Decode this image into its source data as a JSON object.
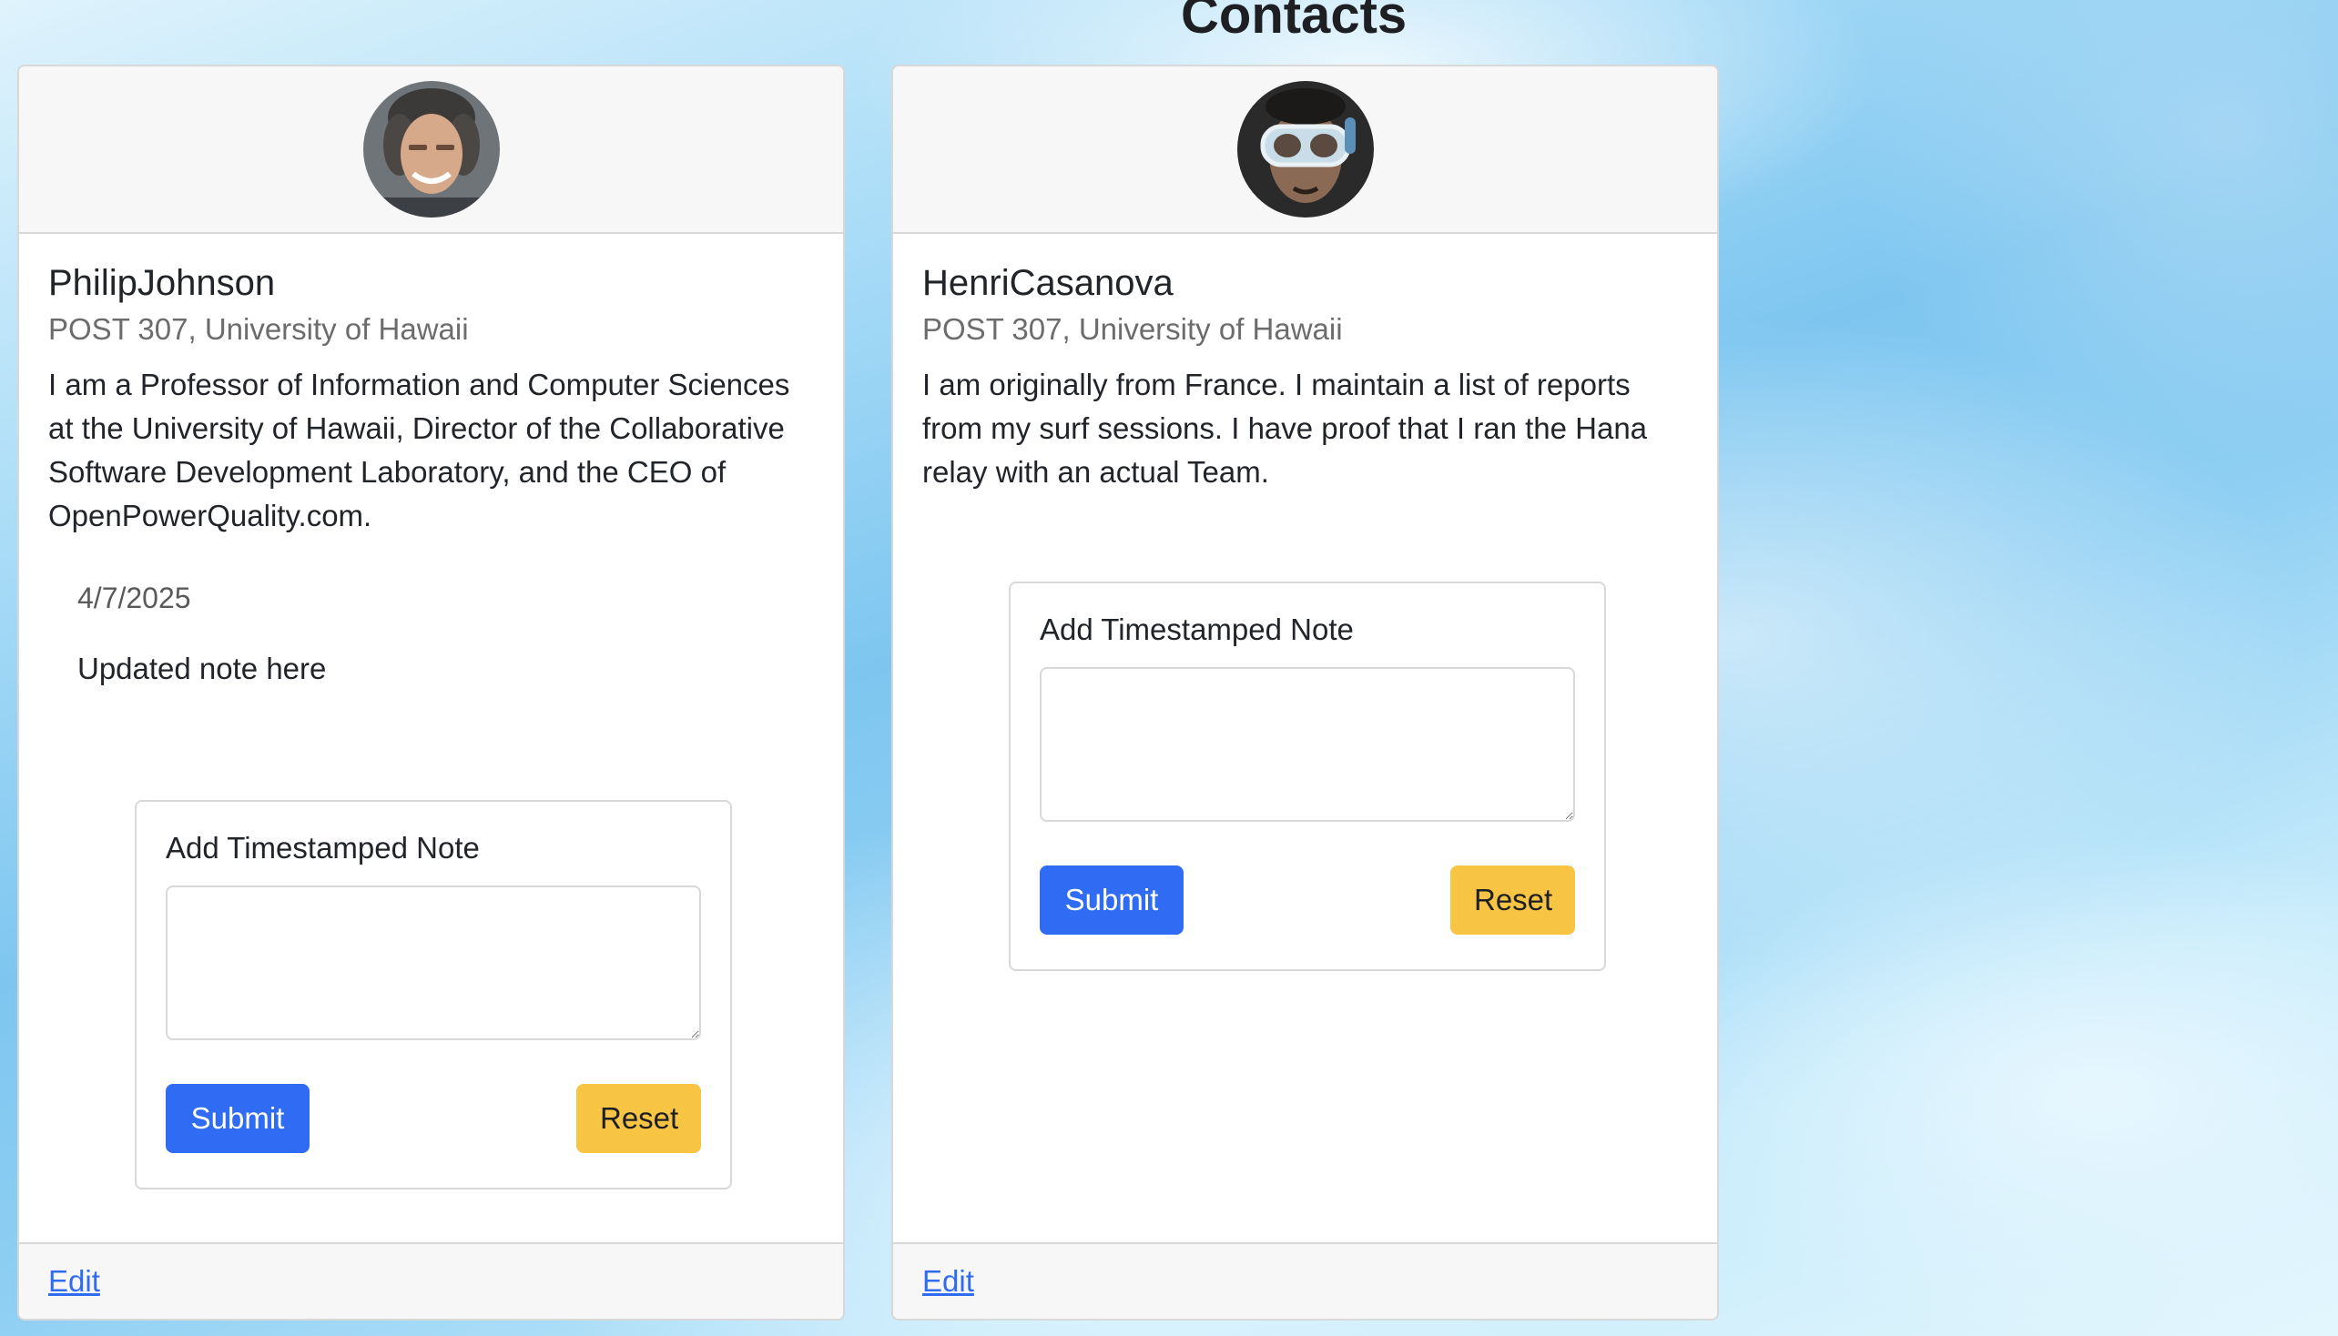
{
  "page": {
    "title": "Contacts"
  },
  "contacts": [
    {
      "name": "PhilipJohnson",
      "address": "POST 307, University of Hawaii",
      "description": "I am a Professor of Information and Computer Sciences at the University of Hawaii, Director of the Collaborative Software Development Laboratory, and the CEO of OpenPowerQuality.com.",
      "notes": [
        {
          "date": "4/7/2025",
          "text": "Updated note here"
        }
      ],
      "form": {
        "label": "Add Timestamped Note",
        "textarea_value": "",
        "submit_label": "Submit",
        "reset_label": "Reset"
      },
      "edit_label": "Edit"
    },
    {
      "name": "HenriCasanova",
      "address": "POST 307, University of Hawaii",
      "description": "I am originally from France. I maintain a list of reports from my surf sessions. I have proof that I ran the Hana relay with an actual Team.",
      "notes": [],
      "form": {
        "label": "Add Timestamped Note",
        "textarea_value": "",
        "submit_label": "Submit",
        "reset_label": "Reset"
      },
      "edit_label": "Edit"
    }
  ],
  "colors": {
    "primary": "#2f6cf3",
    "warning": "#f7c543",
    "card_border": "#d8d8d8",
    "card_header_bg": "#f7f7f7"
  }
}
